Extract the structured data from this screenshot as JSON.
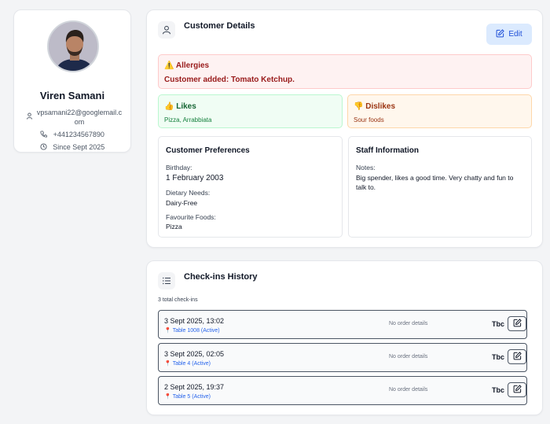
{
  "profile": {
    "name": "Viren Samani",
    "email": "vpsamani22@googlemail.com",
    "phone": "+441234567890",
    "since": "Since Sept 2025"
  },
  "details": {
    "title": "Customer Details",
    "edit_label": "Edit",
    "allergies": {
      "title": "Allergies",
      "text": "Customer added: Tomato Ketchup."
    },
    "likes": {
      "title": "Likes",
      "text": "Pizza, Arrabbiata"
    },
    "dislikes": {
      "title": "Dislikes",
      "text": "Sour foods"
    },
    "preferences": {
      "title": "Customer Preferences",
      "birthday_label": "Birthday:",
      "birthday": "1 February 2003",
      "dietary_label": "Dietary Needs:",
      "dietary": "Dairy-Free",
      "foods_label": "Favourite Foods:",
      "foods": "Pizza"
    },
    "staff": {
      "title": "Staff Information",
      "notes_label": "Notes:",
      "notes": "Big spender, likes a good time. Very chatty and fun to talk to."
    }
  },
  "checkins": {
    "title": "Check-ins History",
    "total": "3 total check-ins",
    "rows": [
      {
        "date": "3 Sept 2025, 13:02",
        "table": "Table 1008 (Active)",
        "order": "No order details",
        "status": "Tbc"
      },
      {
        "date": "3 Sept 2025, 02:05",
        "table": "Table 4 (Active)",
        "order": "No order details",
        "status": "Tbc"
      },
      {
        "date": "2 Sept 2025, 19:37",
        "table": "Table 5 (Active)",
        "order": "No order details",
        "status": "Tbc"
      }
    ]
  },
  "icons": {
    "user": "user-icon",
    "phone": "phone-icon",
    "clock": "clock-icon",
    "warning": "warning-icon",
    "thumbs_up": "thumbs-up-icon",
    "thumbs_down": "thumbs-down-icon",
    "list": "list-icon",
    "edit": "edit-icon",
    "pin": "map-pin-icon"
  },
  "colors": {
    "accent": "#1d4ed8",
    "allergy_bg": "#fef2f2",
    "likes_bg": "#f0fdf4",
    "dislikes_bg": "#fff7ed"
  }
}
